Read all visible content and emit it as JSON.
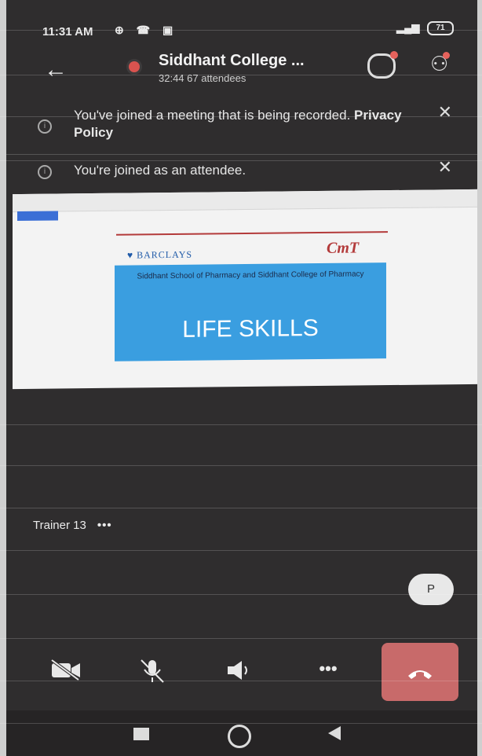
{
  "status": {
    "time": "11:31 AM",
    "icons": "⊕ ☎ ▣",
    "battery": "71",
    "signal": "▂▄▆"
  },
  "header": {
    "back_icon": "arrow-left-icon",
    "title": "Siddhant College ...",
    "subtitle": "32:44  67 attendees"
  },
  "banners": [
    {
      "text": "You've joined a meeting that is being recorded. ",
      "link": "Privacy Policy"
    },
    {
      "text": "You're joined as an attendee.",
      "link": ""
    }
  ],
  "shared_screen": {
    "brand_left": "BARCLAYS",
    "brand_right": "CmT",
    "school": "Siddhant School of Pharmacy and Siddhant College of Pharmacy",
    "headline": "LIFE SKILLS"
  },
  "participant": {
    "name": "Trainer 13",
    "more": "•••"
  },
  "avatar": {
    "initial": "P"
  },
  "controls": {
    "more": "•••"
  },
  "colors": {
    "end_call": "#c86a6a",
    "recording": "#d9534f",
    "slide_box": "#3a9ee0"
  }
}
